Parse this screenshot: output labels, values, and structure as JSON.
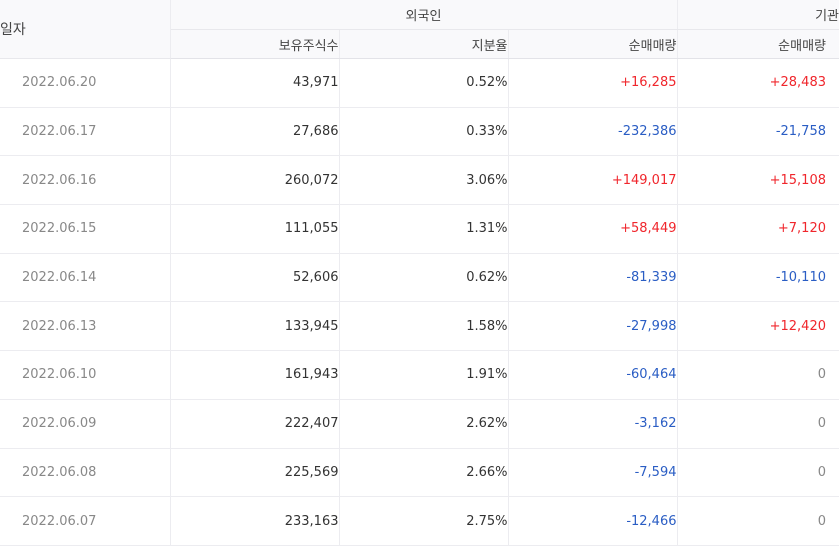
{
  "header": {
    "date_label": "일자",
    "group_foreign": "외국인",
    "group_institution": "기관",
    "col_holdings": "보유주식수",
    "col_ratio": "지분율",
    "col_foreign_net": "순매매량",
    "col_inst_net": "순매매량"
  },
  "colors": {
    "buy": "#f0262c",
    "sell": "#2a5dc4",
    "neutral": "#888888"
  },
  "rows": [
    {
      "date": "2022.06.20",
      "holdings": "43,971",
      "ratio": "0.52%",
      "foreign_net": "+16,285",
      "foreign_dir": "up",
      "inst_net": "+28,483",
      "inst_dir": "up"
    },
    {
      "date": "2022.06.17",
      "holdings": "27,686",
      "ratio": "0.33%",
      "foreign_net": "-232,386",
      "foreign_dir": "down",
      "inst_net": "-21,758",
      "inst_dir": "down"
    },
    {
      "date": "2022.06.16",
      "holdings": "260,072",
      "ratio": "3.06%",
      "foreign_net": "+149,017",
      "foreign_dir": "up",
      "inst_net": "+15,108",
      "inst_dir": "up"
    },
    {
      "date": "2022.06.15",
      "holdings": "111,055",
      "ratio": "1.31%",
      "foreign_net": "+58,449",
      "foreign_dir": "up",
      "inst_net": "+7,120",
      "inst_dir": "up"
    },
    {
      "date": "2022.06.14",
      "holdings": "52,606",
      "ratio": "0.62%",
      "foreign_net": "-81,339",
      "foreign_dir": "down",
      "inst_net": "-10,110",
      "inst_dir": "down"
    },
    {
      "date": "2022.06.13",
      "holdings": "133,945",
      "ratio": "1.58%",
      "foreign_net": "-27,998",
      "foreign_dir": "down",
      "inst_net": "+12,420",
      "inst_dir": "up"
    },
    {
      "date": "2022.06.10",
      "holdings": "161,943",
      "ratio": "1.91%",
      "foreign_net": "-60,464",
      "foreign_dir": "down",
      "inst_net": "0",
      "inst_dir": "zero"
    },
    {
      "date": "2022.06.09",
      "holdings": "222,407",
      "ratio": "2.62%",
      "foreign_net": "-3,162",
      "foreign_dir": "down",
      "inst_net": "0",
      "inst_dir": "zero"
    },
    {
      "date": "2022.06.08",
      "holdings": "225,569",
      "ratio": "2.66%",
      "foreign_net": "-7,594",
      "foreign_dir": "down",
      "inst_net": "0",
      "inst_dir": "zero"
    },
    {
      "date": "2022.06.07",
      "holdings": "233,163",
      "ratio": "2.75%",
      "foreign_net": "-12,466",
      "foreign_dir": "down",
      "inst_net": "0",
      "inst_dir": "zero"
    }
  ]
}
